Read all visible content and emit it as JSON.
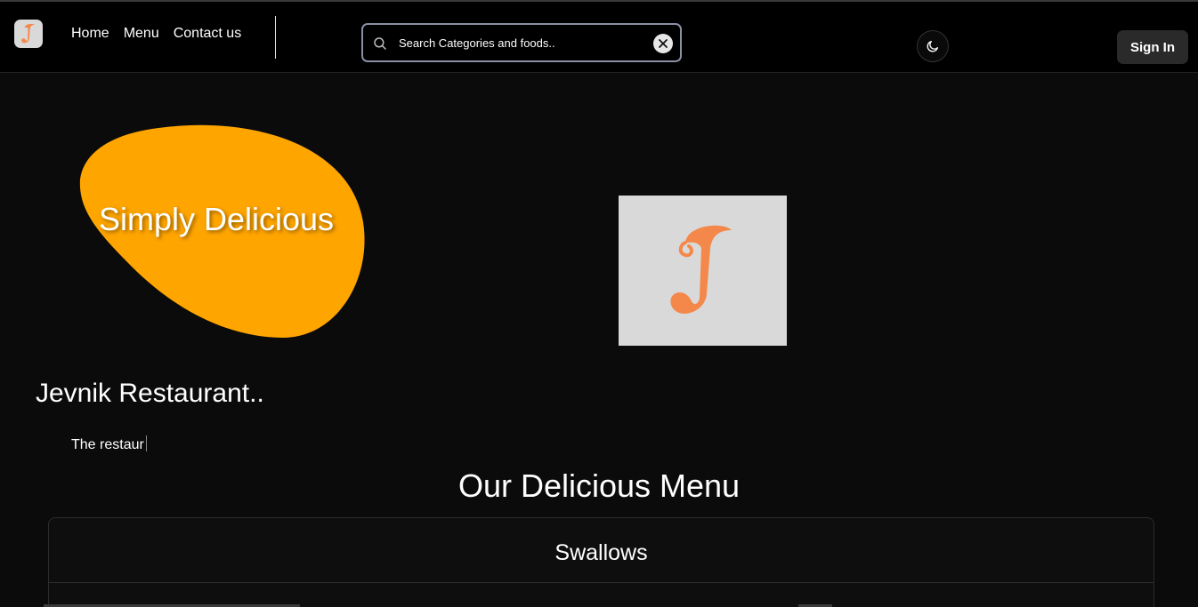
{
  "colors": {
    "accent": "#ffa500",
    "logo_orange": "#f4884a",
    "logo_bg": "#d9d9d9",
    "background": "#0b0b0b",
    "navbar": "#000000"
  },
  "navbar": {
    "logo_icon": "restaurant-logo-j",
    "links": [
      {
        "label": "Home"
      },
      {
        "label": "Menu"
      },
      {
        "label": "Contact us"
      }
    ],
    "search": {
      "placeholder": "Search Categories and foods..",
      "icon": "search-icon",
      "clear_icon": "close-icon"
    },
    "theme_toggle_icon": "moon-icon",
    "sign_in_label": "Sign In"
  },
  "hero": {
    "blob_text": "Simply Delicious",
    "logo_icon": "restaurant-logo-j",
    "restaurant_name": "Jevnik Restaurant..",
    "typing_text": "The restaur"
  },
  "menu": {
    "title": "Our Delicious Menu",
    "categories": [
      {
        "name": "Swallows"
      }
    ]
  }
}
